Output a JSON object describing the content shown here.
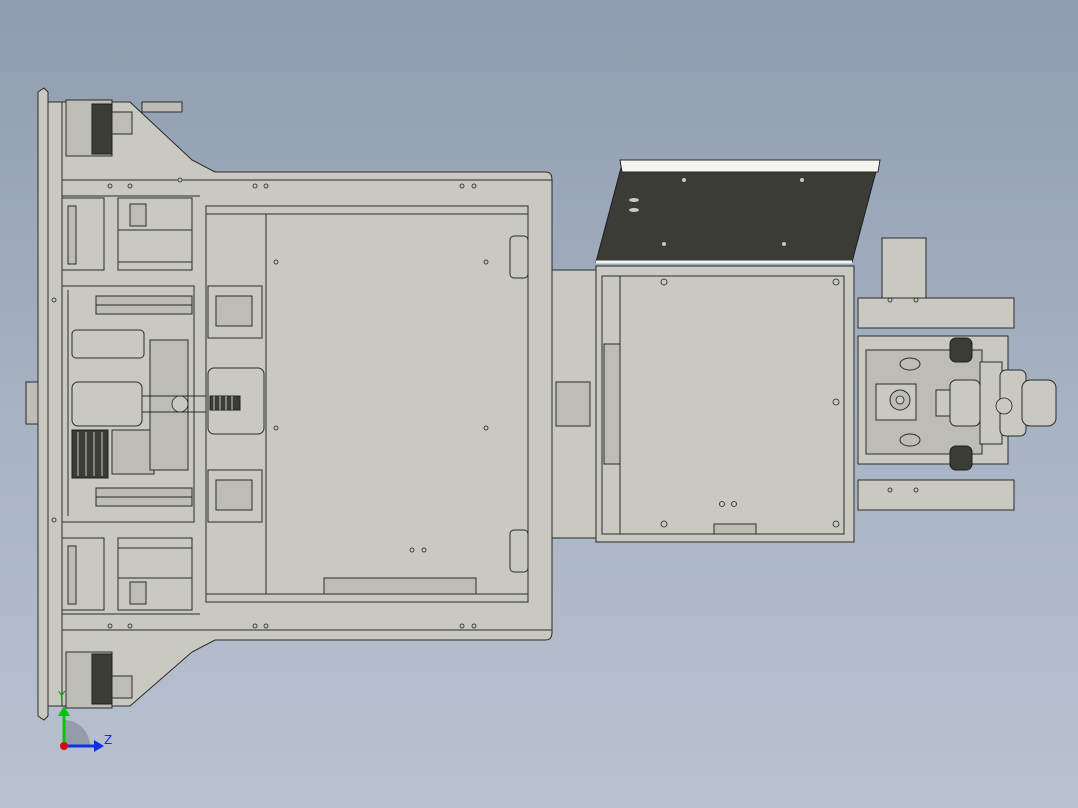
{
  "view": {
    "background_top": "#8f9db0",
    "background_bottom": "#b9c2cf",
    "part_fill": "#c9c9c1",
    "edge_color": "#2a2a2a",
    "lid_color": "#3c3c37"
  },
  "triad": {
    "y_label": "Y",
    "z_label": "Z",
    "y_color": "#10c010",
    "z_color": "#1030e0",
    "origin_color": "#d01010"
  }
}
